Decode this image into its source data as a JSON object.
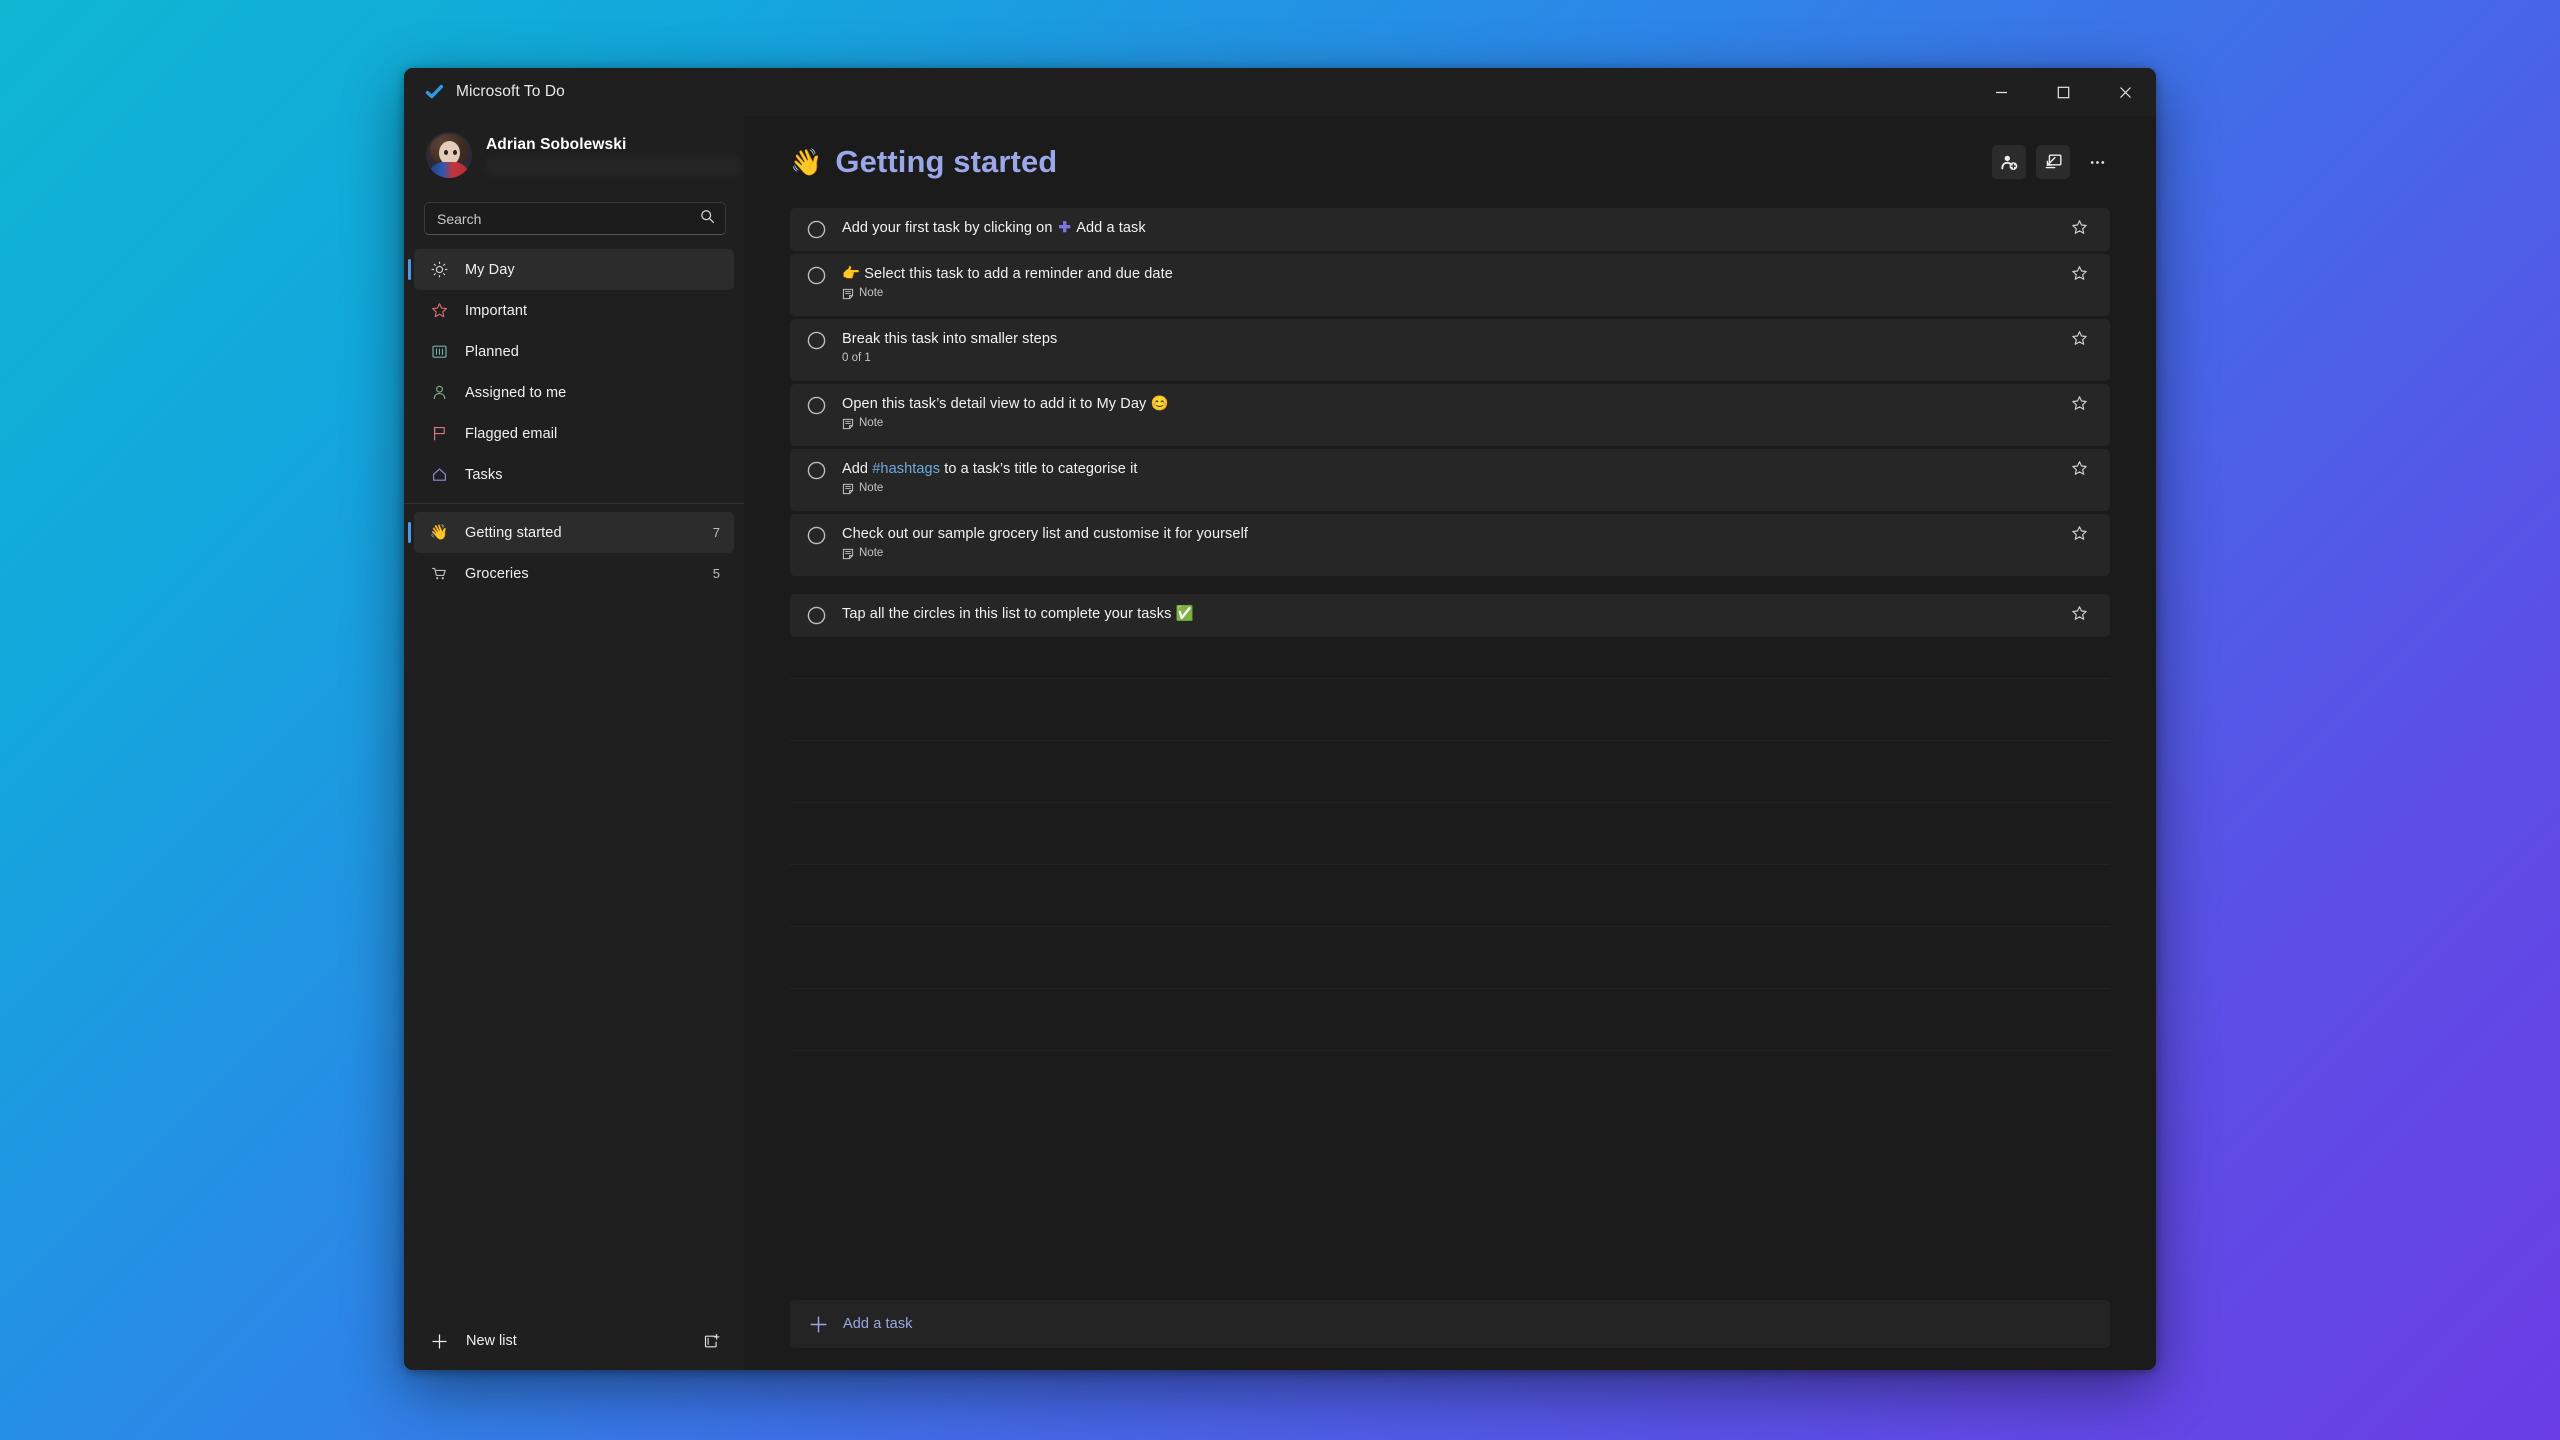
{
  "window": {
    "app_title": "Microsoft To Do",
    "logo_icon": "check-logo-icon",
    "controls": {
      "minimize": "minimize-icon",
      "maximize": "maximize-icon",
      "close": "close-icon"
    }
  },
  "sidebar": {
    "account": {
      "name": "Adrian Sobolewski",
      "email": ""
    },
    "search": {
      "value": "",
      "placeholder": "Search",
      "icon": "search-icon"
    },
    "nav": [
      {
        "label": "My Day",
        "icon": "sun-icon",
        "count": "",
        "selected": true,
        "group": "smart"
      },
      {
        "label": "Important",
        "icon": "star-icon",
        "count": "",
        "selected": false,
        "group": "smart"
      },
      {
        "label": "Planned",
        "icon": "calendar-icon",
        "count": "",
        "selected": false,
        "group": "smart"
      },
      {
        "label": "Assigned to me",
        "icon": "person-icon",
        "count": "",
        "selected": false,
        "group": "smart"
      },
      {
        "label": "Flagged email",
        "icon": "flag-icon",
        "count": "",
        "selected": false,
        "group": "smart"
      },
      {
        "label": "Tasks",
        "icon": "home-icon",
        "count": "",
        "selected": false,
        "group": "smart"
      },
      {
        "label": "Getting started",
        "icon": "waving-hand-emoji",
        "count": "7",
        "selected": false,
        "group": "lists",
        "emoji": "👋"
      },
      {
        "label": "Groceries",
        "icon": "shopping-cart-icon",
        "count": "5",
        "selected": false,
        "group": "lists"
      }
    ],
    "footer": {
      "new_list_label": "New list",
      "new_list_icon": "plus-icon",
      "new_group_icon": "new-group-icon"
    },
    "accent_color": "#4C9BE8"
  },
  "main": {
    "list_emoji": "👋",
    "list_title": "Getting started",
    "title_color": "#9AA7E8",
    "toolbar": [
      {
        "icon": "share-add-person-icon",
        "filled": true
      },
      {
        "icon": "open-suggestions-icon",
        "filled": true
      },
      {
        "icon": "more-options-icon",
        "filled": false
      }
    ],
    "tasks": [
      {
        "title_parts": [
          {
            "text": "Add your first task by clicking on ",
            "style": "normal"
          },
          {
            "text": "✚",
            "style": "plus"
          },
          {
            "text": " Add a task",
            "style": "normal"
          }
        ],
        "meta": "",
        "meta_icon": "",
        "checkbox": "circle-icon",
        "star": "star-icon",
        "tall": false,
        "spaced": false
      },
      {
        "title_parts": [
          {
            "text": "👉 Select this task to add a reminder and due date",
            "style": "normal"
          }
        ],
        "meta": "Note",
        "meta_icon": "note-icon",
        "checkbox": "circle-icon",
        "star": "star-icon",
        "tall": true,
        "spaced": false
      },
      {
        "title_parts": [
          {
            "text": "Break this task into smaller steps",
            "style": "normal"
          }
        ],
        "meta": "0 of 1",
        "meta_icon": "",
        "checkbox": "circle-icon",
        "star": "star-icon",
        "tall": true,
        "spaced": false
      },
      {
        "title_parts": [
          {
            "text": "Open this task’s detail view to add it to My Day 😊",
            "style": "normal"
          }
        ],
        "meta": "Note",
        "meta_icon": "note-icon",
        "checkbox": "circle-icon",
        "star": "star-icon",
        "tall": true,
        "spaced": false
      },
      {
        "title_parts": [
          {
            "text": "Add ",
            "style": "normal"
          },
          {
            "text": "#hashtags",
            "style": "hash"
          },
          {
            "text": " to a task’s title to categorise it",
            "style": "normal"
          }
        ],
        "meta": "Note",
        "meta_icon": "note-icon",
        "checkbox": "circle-icon",
        "star": "star-icon",
        "tall": true,
        "spaced": false
      },
      {
        "title_parts": [
          {
            "text": "Check out our sample grocery list and customise it for yourself",
            "style": "normal"
          }
        ],
        "meta": "Note",
        "meta_icon": "note-icon",
        "checkbox": "circle-icon",
        "star": "star-icon",
        "tall": true,
        "spaced": false
      },
      {
        "title_parts": [
          {
            "text": "Tap all the circles in this list to complete your tasks ✅",
            "style": "normal"
          }
        ],
        "meta": "",
        "meta_icon": "",
        "checkbox": "circle-icon",
        "star": "star-icon",
        "tall": false,
        "spaced": true
      }
    ],
    "add_task": {
      "label": "Add a task",
      "icon": "plus-icon"
    },
    "rule_line_positions": [
      408,
      470,
      532,
      594,
      656,
      718,
      780,
      842
    ]
  }
}
